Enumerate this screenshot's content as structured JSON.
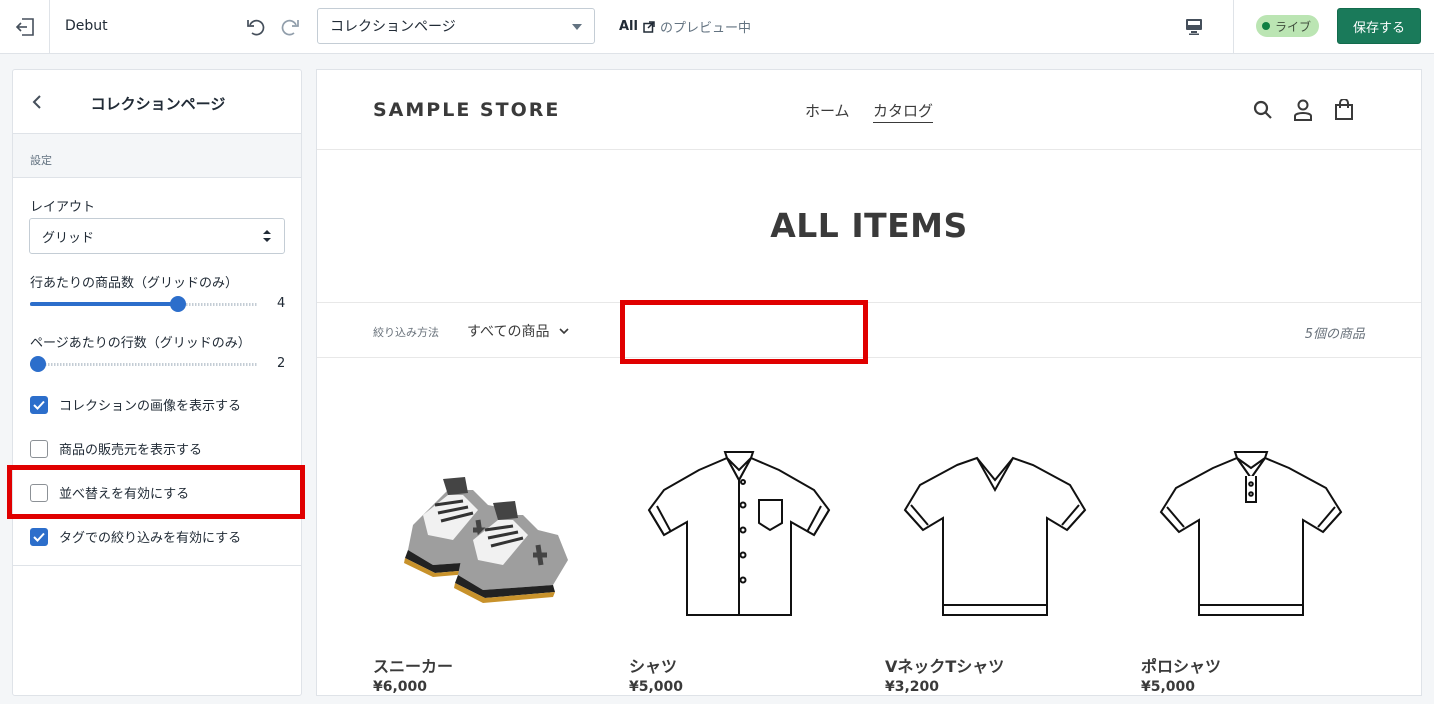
{
  "topbar": {
    "theme_name": "Debut",
    "page_select": "コレクションページ",
    "preview_all": "All",
    "preview_text": "のプレビュー中",
    "live_label": "ライブ",
    "save_label": "保存する"
  },
  "sidebar": {
    "title": "コレクションページ",
    "section_heading": "設定",
    "layout_label": "レイアウト",
    "layout_value": "グリッド",
    "products_per_row_label": "行あたりの商品数（グリッドのみ）",
    "products_per_row_value": "4",
    "products_per_row_fraction": 0.66,
    "rows_per_page_label": "ページあたりの行数（グリッドのみ）",
    "rows_per_page_value": "2",
    "rows_per_page_fraction": 0.0,
    "checkboxes": [
      {
        "label": "コレクションの画像を表示する",
        "checked": true
      },
      {
        "label": "商品の販売元を表示する",
        "checked": false
      },
      {
        "label": "並べ替えを有効にする",
        "checked": false
      },
      {
        "label": "タグでの絞り込みを有効にする",
        "checked": true
      }
    ]
  },
  "store": {
    "logo": "SAMPLE STORE",
    "nav": [
      "ホーム",
      "カタログ"
    ],
    "collection_title": "ALL ITEMS",
    "filter_label": "絞り込み方法",
    "filter_value": "すべての商品",
    "product_count": "5個の商品",
    "products": [
      {
        "name": "スニーカー",
        "price": "¥6,000",
        "icon": "sneaker-image"
      },
      {
        "name": "シャツ",
        "price": "¥5,000",
        "icon": "shirt-image"
      },
      {
        "name": "VネックTシャツ",
        "price": "¥3,200",
        "icon": "vneck-tshirt-image"
      },
      {
        "name": "ポロシャツ",
        "price": "¥5,000",
        "icon": "polo-shirt-image"
      }
    ]
  },
  "colors": {
    "accent": "#2c6ecb",
    "save_button": "#1a7a5a",
    "live_badge": "#bbe5b3",
    "highlight": "#e00000"
  }
}
